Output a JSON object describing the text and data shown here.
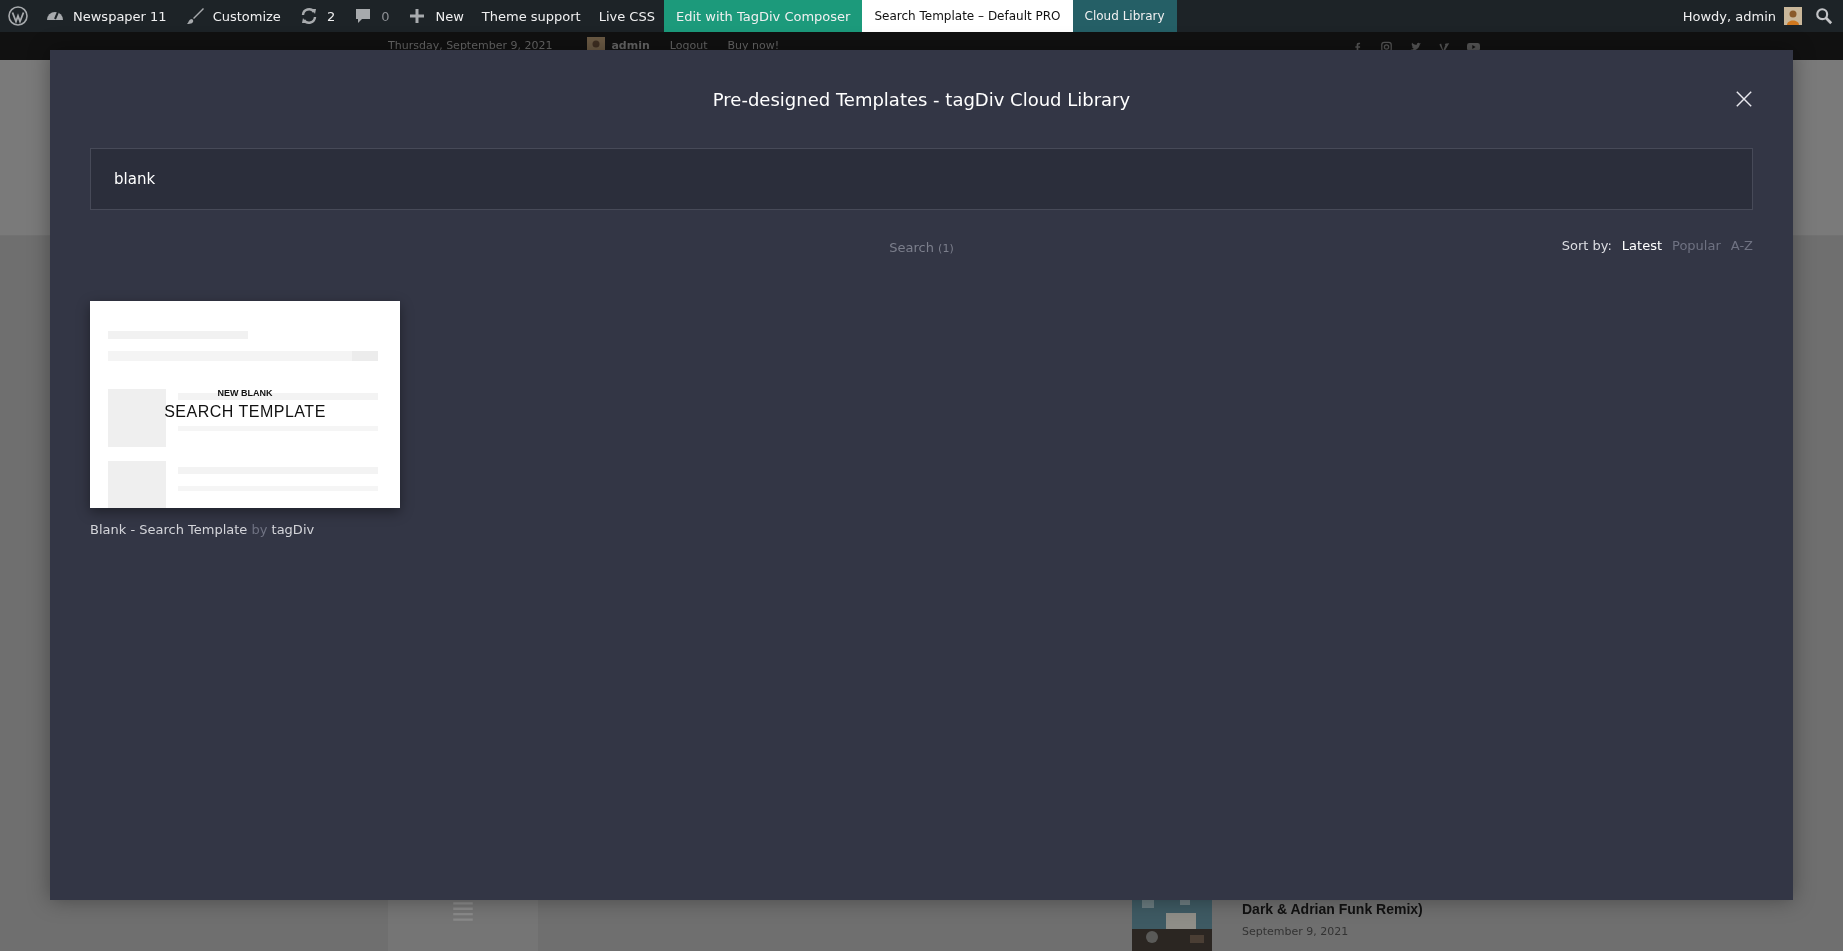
{
  "admin_bar": {
    "site": "Newspaper 11",
    "customize": "Customize",
    "updates": "2",
    "comments": "0",
    "new": "New",
    "links": [
      {
        "label": "Theme support",
        "kind": "plain"
      },
      {
        "label": "Live CSS",
        "kind": "plain"
      },
      {
        "label": "Edit with TagDiv Composer",
        "kind": "green"
      },
      {
        "label": "Search Template – Default PRO",
        "kind": "white"
      },
      {
        "label": "Cloud Library",
        "kind": "teal"
      }
    ],
    "greeting": "Howdy, admin"
  },
  "top_strip": {
    "date": "Thursday, September 9, 2021",
    "user": "admin",
    "logout": "Logout",
    "buy": "Buy now!"
  },
  "modal": {
    "title": "Pre-designed Templates - tagDiv Cloud Library",
    "search": {
      "value": "blank"
    },
    "result_label": "Search",
    "result_count": "(1)",
    "sort_label": "Sort by:",
    "sort_options": [
      {
        "label": "Latest",
        "selected": true
      },
      {
        "label": "Popular",
        "selected": false
      },
      {
        "label": "A-Z",
        "selected": false
      }
    ],
    "templates": [
      {
        "kicker": "NEW BLANK",
        "heading": "SEARCH TEMPLATE",
        "name": "Blank - Search Template",
        "by": "by",
        "author": "tagDiv"
      }
    ]
  },
  "background_post": {
    "title": "Dark & Adrian Funk Remix)",
    "date": "September 9, 2021"
  }
}
